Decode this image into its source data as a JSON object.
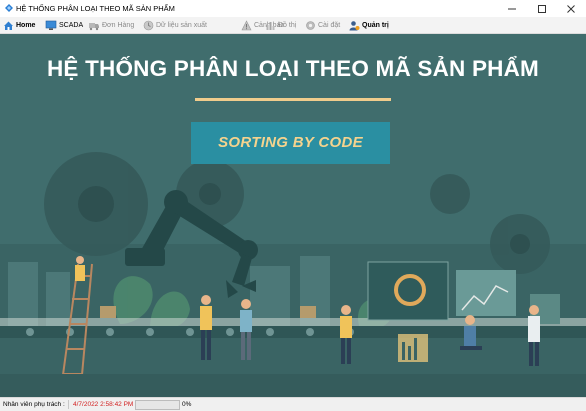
{
  "window": {
    "title": "HỆ THỐNG PHÂN LOẠI THEO MÃ SẢN PHẨM",
    "controls": [
      "minimize",
      "maximize",
      "close"
    ]
  },
  "menu": [
    {
      "label": "Home",
      "icon": "home-icon",
      "enabled": true,
      "selected": true
    },
    {
      "label": "SCADA",
      "icon": "monitor-icon",
      "enabled": true
    },
    {
      "label": "Đơn Hàng",
      "icon": "truck-icon",
      "enabled": false
    },
    {
      "label": "Dữ liệu sản xuất",
      "icon": "clock-icon",
      "enabled": false
    },
    {
      "label": "Cảnh báo",
      "icon": "warning-icon",
      "enabled": false
    },
    {
      "label": "Đồ thị",
      "icon": "chart-icon",
      "enabled": false
    },
    {
      "label": "Cài đặt",
      "icon": "gear-icon",
      "enabled": false
    },
    {
      "label": "Quản trị",
      "icon": "user-admin-icon",
      "enabled": true
    }
  ],
  "hero": {
    "title": "HỆ THỐNG PHÂN LOẠI THEO MÃ SẢN PHẨM",
    "button_label": "SORTING BY CODE",
    "colors": {
      "overlay": "#3e6a6a",
      "accent_rule": "#f0cc8c",
      "button_bg": "#2a8fa2",
      "button_text": "#f5d38e"
    }
  },
  "status": {
    "staff_label": "Nhân viên phụ trách :",
    "datetime": "4/7/2022 2:58:42 PM",
    "progress_percent": 0,
    "progress_text": "0%",
    "datetime_color": "#d21f1f"
  }
}
